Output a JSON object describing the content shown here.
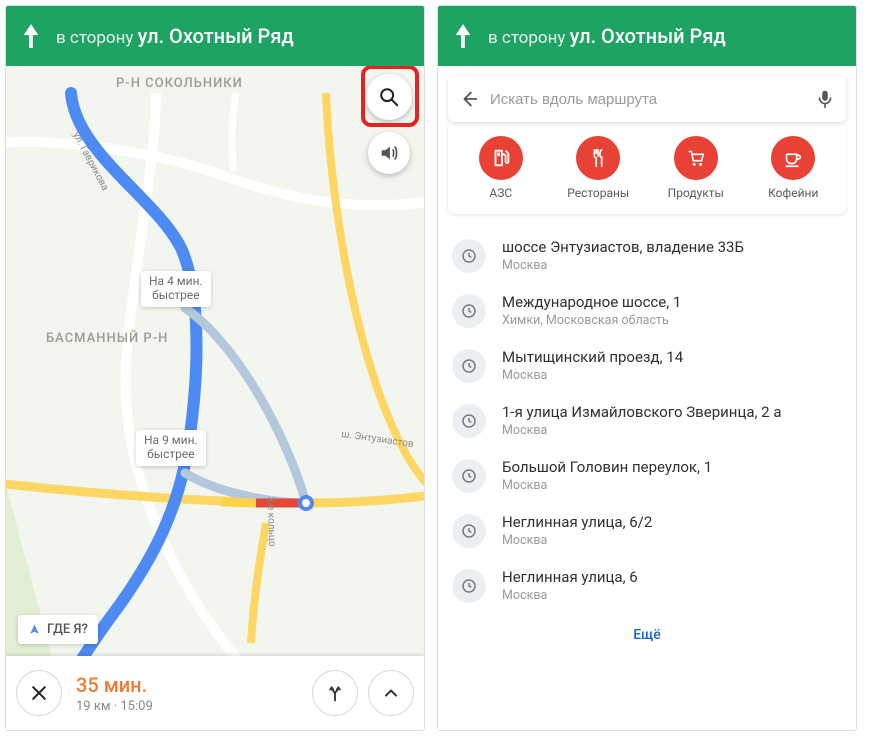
{
  "header": {
    "prefix": "в сторону",
    "destination": "ул. Охотный Ряд"
  },
  "map": {
    "districts": {
      "sokolniki": "Р-Н СОКОЛЬНИКИ",
      "basmanny": "БАСМАННЫЙ Р-Н"
    },
    "streets": {
      "gavrikova": "ул. Гаврикова",
      "entuziastov": "ш. Энтузиастов",
      "ring3": "3-е кольцо"
    },
    "chips": {
      "faster4": "На 4 мин.\nбыстрее",
      "faster9": "На 9 мин.\nбыстрее"
    },
    "where_button": "ГДЕ Я?"
  },
  "eta": {
    "duration": "35 мин.",
    "distance": "19 км",
    "arrival": "15:09"
  },
  "search": {
    "placeholder": "Искать вдоль маршрута"
  },
  "categories": [
    {
      "id": "gas",
      "label": "АЗС"
    },
    {
      "id": "restaurants",
      "label": "Рестораны"
    },
    {
      "id": "groceries",
      "label": "Продукты"
    },
    {
      "id": "coffee",
      "label": "Кофейни"
    }
  ],
  "history": [
    {
      "title": "шоссе Энтузиастов, владение 33Б",
      "sub": "Москва"
    },
    {
      "title": "Международное шоссе, 1",
      "sub": "Химки, Московская область"
    },
    {
      "title": "Мытищинский проезд, 14",
      "sub": "Москва"
    },
    {
      "title": "1-я улица Измайловского Зверинца, 2 а",
      "sub": "Москва"
    },
    {
      "title": "Большой Головин переулок, 1",
      "sub": "Москва"
    },
    {
      "title": "Неглинная улица, 6/2",
      "sub": "Москва"
    },
    {
      "title": "Неглинная улица, 6",
      "sub": "Москва"
    }
  ],
  "more_label": "Ещё"
}
